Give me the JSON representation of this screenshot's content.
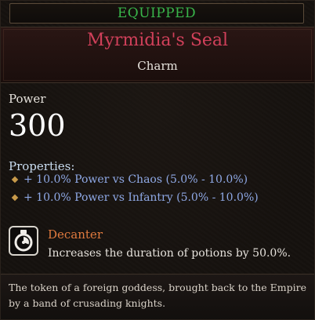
{
  "status": {
    "equipped_label": "EQUIPPED"
  },
  "item": {
    "name": "Myrmidia's Seal",
    "type": "Charm",
    "power_label": "Power",
    "power_value": "300",
    "properties_label": "Properties:",
    "properties": [
      "+ 10.0% Power vs Chaos (5.0% - 10.0%)",
      "+ 10.0% Power vs Infantry (5.0% - 10.0%)"
    ],
    "ability": {
      "icon": "potion-clock-icon",
      "name": "Decanter",
      "description": "Increases the duration of potions by 50.0%."
    },
    "flavor_text": "The token of a foreign goddess, brought back to the Empire by a band of crusading knights."
  },
  "colors": {
    "equipped": "#39b54a",
    "item_name": "#d0405a",
    "property": "#8fa9e6",
    "ability_name": "#e07a3e",
    "diamond": "#c89a4a"
  }
}
